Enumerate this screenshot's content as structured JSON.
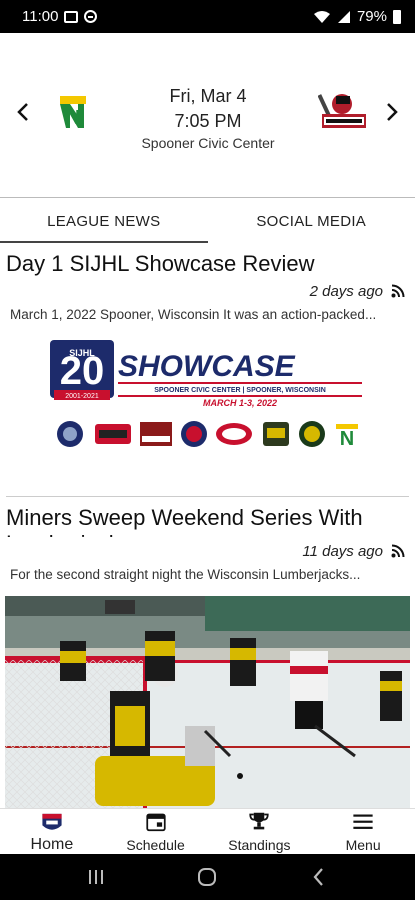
{
  "status_bar": {
    "time": "11:00",
    "battery": "79%"
  },
  "game": {
    "date": "Fri, Mar 4",
    "time": "7:05 PM",
    "venue": "Spooner Civic Center",
    "home_team_logo": "N",
    "away_team_logo": "lumberjacks-logo"
  },
  "tabs": [
    {
      "label": "LEAGUE NEWS",
      "active": true
    },
    {
      "label": "SOCIAL MEDIA",
      "active": false
    }
  ],
  "articles": [
    {
      "title": "Day 1 SIJHL Showcase Review",
      "date": "2 days ago",
      "excerpt": "March 1, 2022 Spooner, Wisconsin It was an action-packed..."
    },
    {
      "title": "Miners Sweep Weekend Series With Lumberjacks",
      "date": "11 days ago",
      "excerpt": "For the second straight night the Wisconsin Lumberjacks..."
    }
  ],
  "showcase": {
    "number": "20",
    "badge_text": "SIJHL",
    "years": "2001-2021",
    "title": "SHOWCASE",
    "subtitle": "SPOONER CIVIC CENTER | SPOONER, WISCONSIN",
    "dates": "MARCH 1-3, 2022",
    "last_logo": "N"
  },
  "bottom_nav": [
    {
      "label": "Home",
      "icon": "home-logo-icon",
      "active": true
    },
    {
      "label": "Schedule",
      "icon": "calendar-icon",
      "active": false
    },
    {
      "label": "Standings",
      "icon": "trophy-icon",
      "active": false
    },
    {
      "label": "Menu",
      "icon": "hamburger-menu-icon",
      "active": false
    }
  ],
  "colors": {
    "accent": "#1d2b6b",
    "red": "#c8102e",
    "green": "#1f8a3a",
    "gold": "#d6b800"
  }
}
